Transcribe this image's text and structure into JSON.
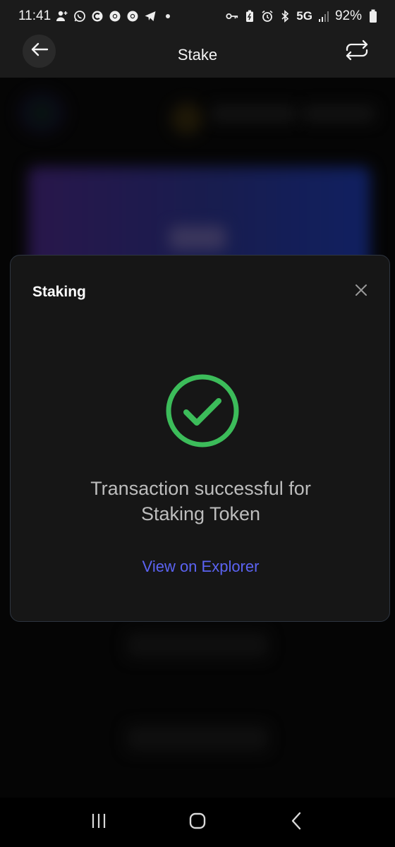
{
  "status_bar": {
    "time": "11:41",
    "network": "5G",
    "battery": "92%",
    "left_icons": [
      "add-person-icon",
      "whatsapp-icon",
      "c-app-icon",
      "chrome-icon",
      "chrome-icon",
      "telegram-icon",
      "dot-icon"
    ],
    "right_icons": [
      "key-icon",
      "battery-saver-icon",
      "alarm-icon",
      "bluetooth-icon",
      "signal-icon",
      "battery-icon"
    ]
  },
  "app_bar": {
    "title": "Stake",
    "back_icon": "arrow-left-icon",
    "action_icon": "repeat-icon"
  },
  "modal": {
    "title": "Staking",
    "close_icon": "close-icon",
    "status_icon": "check-circle-icon",
    "message_line1": "Transaction successful for",
    "message_line2": "Staking Token",
    "link_label": "View on Explorer"
  },
  "colors": {
    "success": "#3cbc5a",
    "link": "#5b63f2",
    "modal_bg": "#161616",
    "bar_bg": "#1b1b1b"
  },
  "nav_bar": {
    "icons": [
      "recent-apps-icon",
      "home-icon",
      "back-icon"
    ]
  }
}
